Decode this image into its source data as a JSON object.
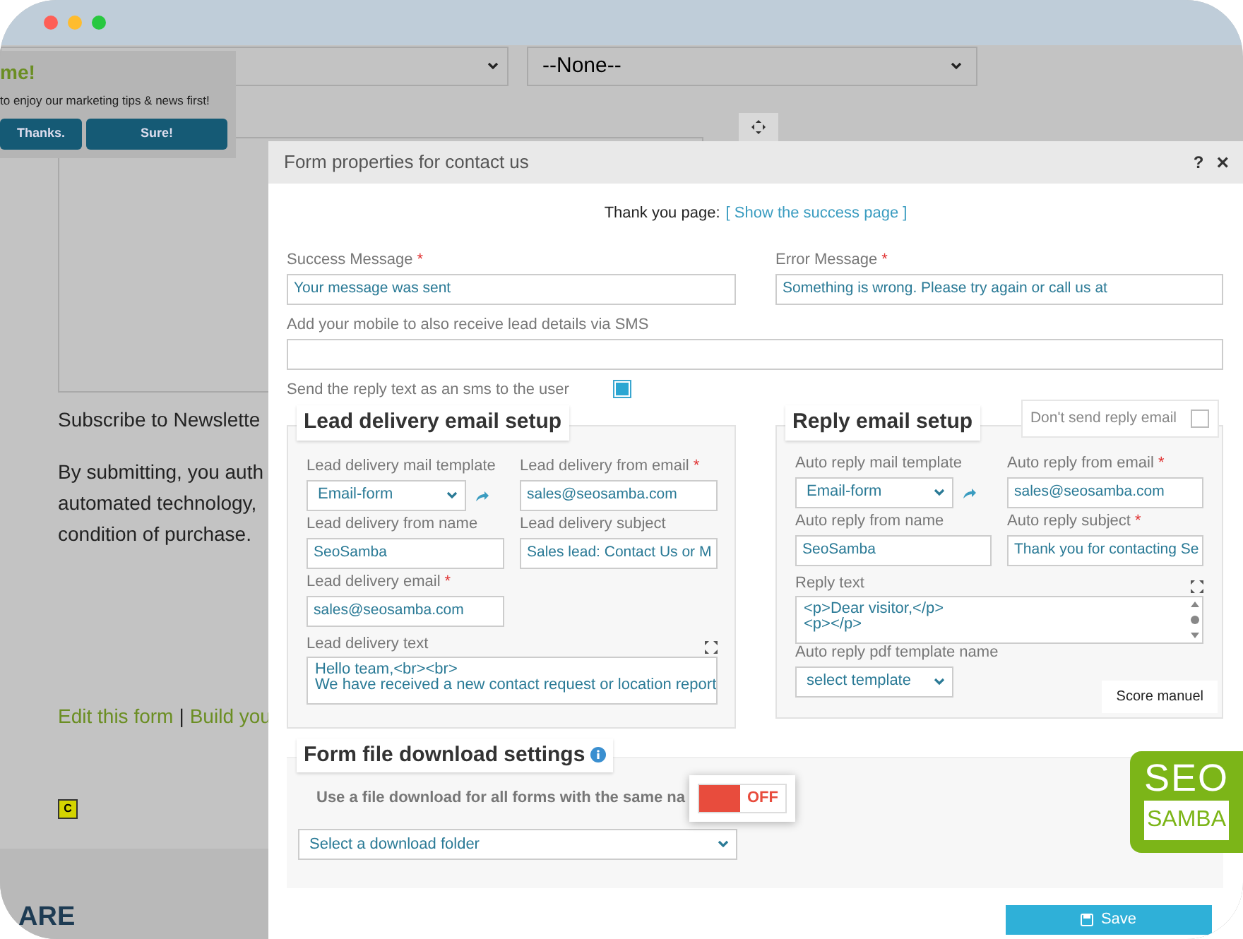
{
  "background_page": {
    "none_select": "--None--",
    "newsletter_label": "Subscribe to Newslette",
    "consent_lines": [
      "By submitting, you auth",
      "automated technology,",
      "condition of purchase."
    ],
    "links": [
      {
        "kind": "link",
        "text": "Edit this form"
      },
      {
        "kind": "separator",
        "text": "|"
      },
      {
        "kind": "link",
        "text": "Build you"
      }
    ],
    "badge": "C",
    "footer_text": "ARE"
  },
  "popup": {
    "title": "me!",
    "text": "to enjoy our marketing tips & news first!",
    "buttons": [
      "Thanks.",
      "Sure!"
    ]
  },
  "dialog": {
    "title": "Form properties for contact us",
    "help": "?",
    "close": "×",
    "thank_you": {
      "label": "Thank you page:",
      "link": "[ Show the success page ]"
    },
    "messages": [
      {
        "label": "Success Message",
        "required_mark": "*",
        "value": "Your message was sent"
      },
      {
        "label": "Error Message",
        "required_mark": "*",
        "value": "Something is wrong. Please try again or call us at"
      }
    ],
    "mobile": {
      "label": "Add your mobile to also receive lead details via SMS"
    },
    "sms": {
      "label": "Send the reply text as an sms to the user",
      "checked": true
    },
    "lead": {
      "title": "Lead delivery email setup",
      "fields": [
        {
          "kind": "template_select",
          "label": "Lead delivery mail template",
          "value": "Email-form"
        },
        {
          "kind": "input",
          "label": "Lead delivery from email",
          "required_mark": "*",
          "value": "sales@seosamba.com"
        },
        {
          "kind": "input",
          "label": "Lead delivery from name",
          "value": "SeoSamba"
        },
        {
          "kind": "input",
          "label": "Lead delivery subject",
          "value": "Sales lead: Contact Us or M"
        },
        {
          "kind": "input",
          "label": "Lead delivery email",
          "required_mark": "*",
          "value": "sales@seosamba.com"
        },
        {
          "kind": "textarea",
          "label": "Lead delivery text",
          "lines": [
            "Hello team,<br><br>",
            "We have received a new contact request or location report"
          ]
        }
      ]
    },
    "reply": {
      "title": "Reply email setup",
      "dont_send": {
        "label": "Don't send reply email",
        "checked": false
      },
      "fields": [
        {
          "kind": "template_select",
          "label": "Auto reply mail template",
          "value": "Email-form"
        },
        {
          "kind": "input",
          "label": "Auto reply from email",
          "required_mark": "*",
          "value": "sales@seosamba.com"
        },
        {
          "kind": "input",
          "label": "Auto reply from name",
          "value": "SeoSamba"
        },
        {
          "kind": "input",
          "label": "Auto reply subject",
          "required_mark": "*",
          "value": "Thank you for contacting Se"
        },
        {
          "kind": "textarea",
          "label": "Reply text",
          "lines": [
            "<p>Dear visitor,</p>",
            "<p></p>"
          ]
        },
        {
          "kind": "select",
          "label": "Auto reply pdf template name",
          "value": "select template"
        }
      ],
      "note": "Score manuel"
    },
    "download": {
      "title": "Form file download settings",
      "toggle": {
        "label": "Use a file download for all forms with the same na",
        "on": false,
        "text": "OFF"
      },
      "folder_select": "Select a download folder"
    },
    "logo": {
      "top": "SEO",
      "bottom": "SAMBA"
    },
    "save": "Save"
  }
}
